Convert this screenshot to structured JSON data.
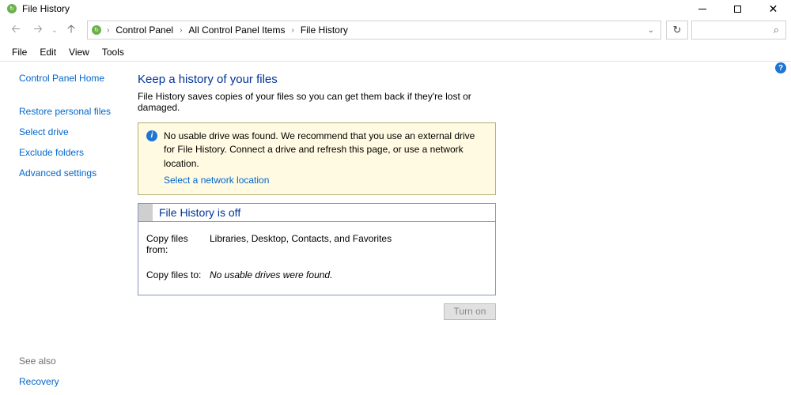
{
  "window": {
    "title": "File History"
  },
  "breadcrumbs": [
    "Control Panel",
    "All Control Panel Items",
    "File History"
  ],
  "menu": [
    "File",
    "Edit",
    "View",
    "Tools"
  ],
  "sidebar": {
    "home": "Control Panel Home",
    "items": [
      "Restore personal files",
      "Select drive",
      "Exclude folders",
      "Advanced settings"
    ],
    "see_also_h": "See also",
    "see_also": [
      "Recovery"
    ]
  },
  "page": {
    "title": "Keep a history of your files",
    "desc": "File History saves copies of your files so you can get them back if they're lost or damaged."
  },
  "notice": {
    "text": "No usable drive was found. We recommend that you use an external drive for File History. Connect a drive and refresh this page, or use a network location.",
    "link": "Select a network location"
  },
  "status": {
    "title": "File History is off",
    "copy_from_label": "Copy files from:",
    "copy_from_value": "Libraries, Desktop, Contacts, and Favorites",
    "copy_to_label": "Copy files to:",
    "copy_to_value": "No usable drives were found."
  },
  "buttons": {
    "turn_on": "Turn on"
  }
}
